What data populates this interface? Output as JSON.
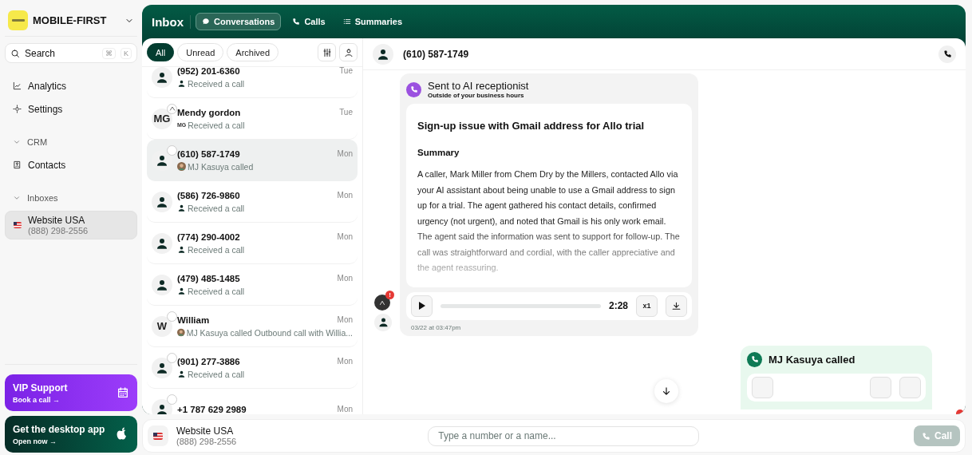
{
  "sidebar": {
    "workspace": "MOBILE-FIRST",
    "search": {
      "placeholder": "Search",
      "keys": [
        "⌘",
        "K"
      ]
    },
    "items": [
      {
        "kind": "link",
        "label": "Analytics"
      },
      {
        "kind": "link",
        "label": "Settings"
      },
      {
        "kind": "section",
        "label": "CRM",
        "expanded": true
      },
      {
        "kind": "link",
        "label": "Contacts"
      },
      {
        "kind": "section",
        "label": "Inboxes",
        "expanded": true
      },
      {
        "kind": "inbox",
        "label": "Website USA",
        "sub": "(888) 298-2556",
        "selected": true
      }
    ],
    "promos": [
      {
        "kind": "vip",
        "title": "VIP Support",
        "link": "Book a call →"
      },
      {
        "kind": "desktop",
        "title": "Get the desktop app",
        "link": "Open now →"
      }
    ]
  },
  "header": {
    "title": "Inbox",
    "tabs": [
      {
        "label": "Conversations",
        "selected": true
      },
      {
        "label": "Calls",
        "selected": false
      },
      {
        "label": "Summaries",
        "selected": false
      }
    ]
  },
  "filters": [
    {
      "label": "All",
      "selected": true
    },
    {
      "label": "Unread",
      "selected": false
    },
    {
      "label": "Archived",
      "selected": false
    }
  ],
  "conversations": [
    {
      "name": "(952) 201-6360",
      "preview": "Received a call",
      "time": "Tue",
      "selected": false
    },
    {
      "name": "Mendy gordon",
      "initials": "MG",
      "ai_badge": true,
      "agent_initials": "MG",
      "preview": "Received a call",
      "time": "Tue",
      "selected": false
    },
    {
      "name": "(610) 587-1749",
      "checked": false,
      "agent_photo": true,
      "preview": "MJ Kasuya called",
      "time": "Mon",
      "selected": true
    },
    {
      "name": "(586) 726-9860",
      "preview": "Received a call",
      "time": "Mon",
      "selected": false
    },
    {
      "name": "(774) 290-4002",
      "preview": "Received a call",
      "time": "Mon",
      "selected": false
    },
    {
      "name": "(479) 485-1485",
      "preview": "Received a call",
      "time": "Mon",
      "selected": false
    },
    {
      "name": "William",
      "initials": "W",
      "checked": false,
      "agent_photo": true,
      "preview": "MJ Kasuya called Outbound call with Willia...",
      "time": "Mon",
      "selected": false
    },
    {
      "name": "(901) 277-3886",
      "checked": false,
      "preview": "Received a call",
      "time": "Mon",
      "selected": false
    },
    {
      "name": "+1 787 629 2989",
      "checked": false,
      "time": "Mon",
      "selected": false
    }
  ],
  "detail": {
    "contact": "(610) 587-1749",
    "messages": [
      {
        "kind": "ai",
        "alert": "!",
        "title": "Sent to AI receptionist",
        "subtitle": "Outside of your business hours",
        "heading": "Sign-up issue with Gmail address for Allo trial",
        "section": "Summary",
        "body": "A caller, Mark Miller from Chem Dry by the Millers, contacted Allo via your AI assistant about being unable to use a Gmail address to sign up for a trial. The agent gathered his contact details, confirmed urgency (not urgent), and noted that Gmail is his only work email. The agent said the information was sent to support for follow-up. The call was straightforward and cordial, with the caller appreciative and the agent reassuring.",
        "duration": "2:28",
        "speed": "x1",
        "timestamp": "03/22 at 03:47pm"
      },
      {
        "kind": "outbound",
        "title": "MJ Kasuya called"
      }
    ]
  },
  "composer": {
    "inbox": "Website USA",
    "number": "(888) 298-2556",
    "placeholder": "Type a number or a name...",
    "call": "Call",
    "call_disabled": true
  }
}
